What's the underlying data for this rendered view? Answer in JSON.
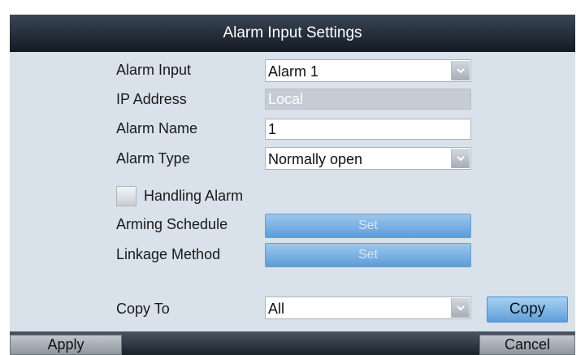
{
  "dialog": {
    "title": "Alarm Input Settings"
  },
  "fields": {
    "alarm_input": {
      "label": "Alarm Input",
      "value": "Alarm 1"
    },
    "ip_address": {
      "label": "IP Address",
      "value": "Local"
    },
    "alarm_name": {
      "label": "Alarm Name",
      "value": "1"
    },
    "alarm_type": {
      "label": "Alarm Type",
      "value": "Normally open"
    },
    "handling_alarm": {
      "label": "Handling Alarm",
      "checked": false
    },
    "arming_schedule": {
      "label": "Arming Schedule",
      "button": "Set"
    },
    "linkage_method": {
      "label": "Linkage Method",
      "button": "Set"
    },
    "copy_to": {
      "label": "Copy To",
      "value": "All",
      "button": "Copy"
    }
  },
  "footer": {
    "apply": "Apply",
    "cancel": "Cancel"
  },
  "icons": {
    "dropdown": "chevron-down-icon",
    "checkbox": "checkbox-icon"
  },
  "colors": {
    "titlebar": "#1b232d",
    "panel": "#d9e1ea",
    "button_blue": "#6aa6dc"
  }
}
